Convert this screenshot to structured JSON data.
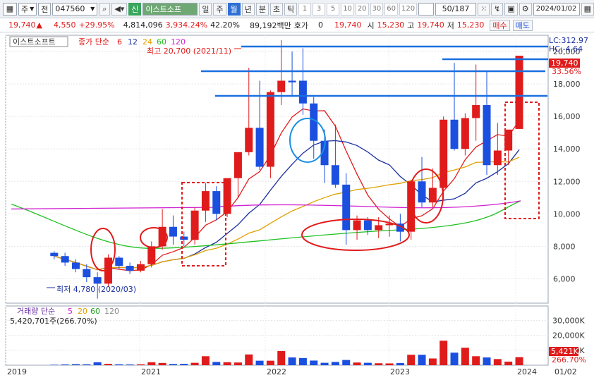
{
  "toolbar": {
    "mode": "주",
    "market": "전",
    "code": "047560",
    "badge": "신",
    "name": "이스트소프",
    "periods": [
      "일",
      "주",
      "월",
      "년",
      "분",
      "초",
      "틱"
    ],
    "active_period": "월",
    "nums": [
      "1",
      "3",
      "5",
      "10",
      "20",
      "30",
      "60",
      "120"
    ],
    "count": "50/187",
    "date": "2024/01/02"
  },
  "quote": {
    "price": "19,740",
    "change": "4,550",
    "change_pct": "+29.95%",
    "volume": "4,814,096",
    "vol_pct": "3,934.24%",
    "turnover": "42.20%",
    "amount": "89,192백만",
    "hoga_label": "호가",
    "hoga": "0",
    "price2": "19,740",
    "open_label": "시",
    "open": "15,230",
    "high_label": "고",
    "high": "19,740",
    "low_label": "저",
    "low": "15,230",
    "buy": "매수",
    "sell": "매도"
  },
  "legend": {
    "name": "이스트소프트",
    "ma_label": "종가 단순",
    "ma": [
      "6",
      "12",
      "24",
      "60",
      "120"
    ],
    "vol_label": "거래량 단순",
    "vol_ma": [
      "5",
      "20",
      "60",
      "120"
    ],
    "vol_value": "5,420,701주(266.70%)"
  },
  "annotations": {
    "high": "최고 20,700 (2021/11)",
    "low": "최저 4,780 (2020/03)",
    "lc": "LC:312.97",
    "hc": "HC:-4.64",
    "price_tag": "19,740",
    "price_pct": "33.56%",
    "vol_tag": "5,421K",
    "vol_pct": "266.70%"
  },
  "colors": {
    "up": "#e01b1b",
    "down": "#1b4fe0",
    "ma6": "#e01b1b",
    "ma12": "#1a2fa0",
    "ma24": "#e0a000",
    "ma60": "#22c022",
    "ma120": "#d020d0"
  },
  "chart_data": {
    "type": "candlestick",
    "price_axis": [
      "6,000",
      "8,000",
      "10,000",
      "12,000",
      "14,000",
      "16,000",
      "18,000",
      "20,000"
    ],
    "price_range": [
      4500,
      21000
    ],
    "volume_axis": [
      "10,000K",
      "20,000K",
      "30,000K"
    ],
    "volume_range": [
      0,
      34000
    ],
    "x_labels": [
      "2019",
      "2021",
      "2022",
      "2023",
      "2024",
      "01/02"
    ],
    "candles": [
      [
        7600,
        7700,
        7200,
        7400
      ],
      [
        7400,
        7600,
        6800,
        7000
      ],
      [
        7000,
        7200,
        6400,
        6600
      ],
      [
        6600,
        6900,
        5800,
        6100
      ],
      [
        6100,
        6400,
        4780,
        5700
      ],
      [
        5700,
        7500,
        5500,
        7300
      ],
      [
        7300,
        7400,
        6600,
        6800
      ],
      [
        6800,
        7000,
        6300,
        6500
      ],
      [
        6500,
        7100,
        6400,
        6900
      ],
      [
        6900,
        8300,
        6700,
        8000
      ],
      [
        8000,
        10300,
        7800,
        9200
      ],
      [
        9200,
        9900,
        8100,
        8600
      ],
      [
        8600,
        8900,
        8000,
        8400
      ],
      [
        8400,
        10400,
        8100,
        10200
      ],
      [
        10200,
        11900,
        9500,
        11400
      ],
      [
        11400,
        11700,
        9600,
        10000
      ],
      [
        10000,
        12000,
        9800,
        12200
      ],
      [
        12200,
        13500,
        11000,
        13800
      ],
      [
        13800,
        19000,
        13600,
        15300
      ],
      [
        15300,
        18200,
        12700,
        12900
      ],
      [
        12900,
        17600,
        12200,
        17500
      ],
      [
        17500,
        20700,
        16700,
        18200
      ],
      [
        18200,
        20000,
        17200,
        18100
      ],
      [
        18200,
        20200,
        16100,
        16800
      ],
      [
        16800,
        17200,
        13400,
        14500
      ],
      [
        14500,
        15200,
        11900,
        13000
      ],
      [
        13000,
        15500,
        11600,
        11800
      ],
      [
        11800,
        12500,
        8100,
        9000
      ],
      [
        9000,
        9900,
        8400,
        9600
      ],
      [
        9600,
        9800,
        8700,
        9000
      ],
      [
        9000,
        9800,
        8500,
        9300
      ],
      [
        9300,
        9900,
        8600,
        9400
      ],
      [
        9400,
        10000,
        8300,
        8900
      ],
      [
        8900,
        12100,
        8400,
        12000
      ],
      [
        12000,
        13500,
        10400,
        10700
      ],
      [
        10700,
        12800,
        10400,
        11600
      ],
      [
        11600,
        16000,
        10900,
        15800
      ],
      [
        15800,
        19300,
        13900,
        14000
      ],
      [
        14000,
        16200,
        13600,
        15900
      ],
      [
        15900,
        19200,
        14500,
        16700
      ],
      [
        16700,
        18800,
        12400,
        13000
      ],
      [
        13000,
        15600,
        12400,
        13900
      ],
      [
        13900,
        14100,
        13000,
        15190
      ],
      [
        15230,
        19740,
        15230,
        19740
      ]
    ],
    "volumes": [
      300,
      500,
      700,
      600,
      2000,
      900,
      600,
      500,
      600,
      2000,
      1500,
      800,
      900,
      1600,
      6000,
      2200,
      2000,
      1800,
      7200,
      3000,
      3000,
      9500,
      5200,
      4800,
      3100,
      1600,
      2200,
      3500,
      1800,
      1600,
      1300,
      1200,
      1400,
      7000,
      7000,
      4500,
      16400,
      8400,
      11700,
      6000,
      5200,
      4100,
      2400,
      5400
    ]
  }
}
